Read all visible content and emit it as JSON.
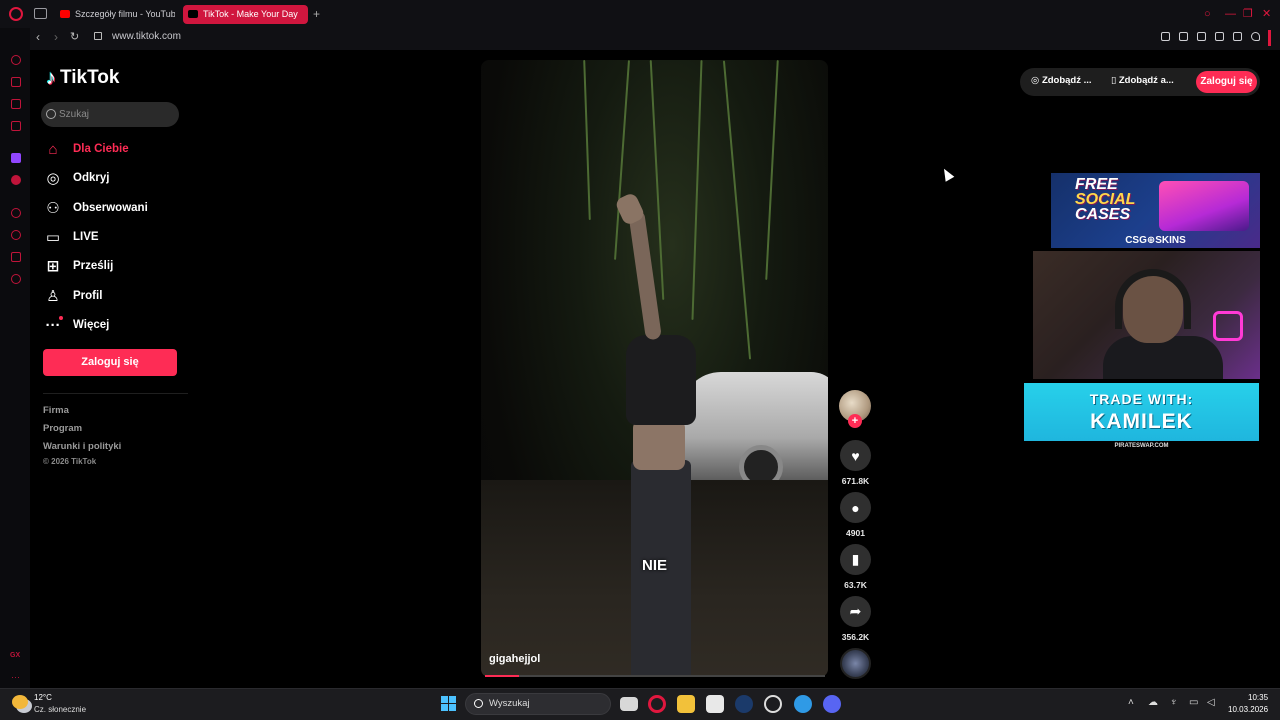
{
  "browser": {
    "tabs": [
      {
        "label": "Szczegóły filmu - YouTube"
      },
      {
        "label": "TikTok - Make Your Day"
      }
    ],
    "address": "www.tiktok.com"
  },
  "tiktok": {
    "logo_text": "TikTok",
    "search_placeholder": "Szukaj",
    "nav": [
      {
        "label": "Dla Ciebie",
        "icon": "home-icon"
      },
      {
        "label": "Odkryj",
        "icon": "compass-icon"
      },
      {
        "label": "Obserwowani",
        "icon": "following-icon"
      },
      {
        "label": "LIVE",
        "icon": "live-icon"
      },
      {
        "label": "Prześlij",
        "icon": "upload-icon"
      },
      {
        "label": "Profil",
        "icon": "profile-icon"
      },
      {
        "label": "Więcej",
        "icon": "more-icon"
      }
    ],
    "login_button": "Zaloguj się",
    "footer": {
      "links": [
        "Firma",
        "Program",
        "Warunki i polityki"
      ],
      "copyright": "© 2026 TikTok"
    },
    "video": {
      "caption": "NIE",
      "author": "gigahejjol",
      "progress": 0.1
    },
    "actions": {
      "likes": "671.8K",
      "comments": "4901",
      "saves": "63.7K",
      "shares": "356.2K"
    },
    "topbar": {
      "get_coins": "Zdobądź ...",
      "get_app": "Zdobądź a...",
      "login": "Zaloguj się"
    }
  },
  "overlay": {
    "ad_line1": "FREE",
    "ad_line2": "SOCIAL",
    "ad_line3": "CASES",
    "ad_brand": "CSG⊕SKINS",
    "trade_line1": "TRADE WITH:",
    "trade_line2": "KAMILEK",
    "trade_site": "PIRATESWAP.COM"
  },
  "taskbar": {
    "temperature": "12°C",
    "weather": "Cz. słonecznie",
    "search": "Wyszukaj",
    "time": "10:35",
    "date": "10.03.2026"
  },
  "colors": {
    "accent": "#fe2c55",
    "opera": "#e0173e"
  }
}
